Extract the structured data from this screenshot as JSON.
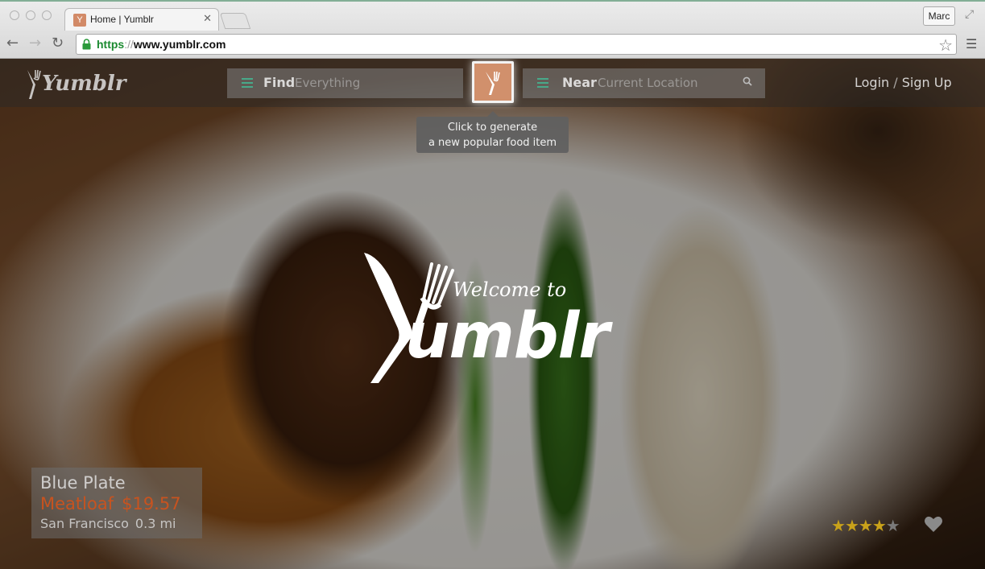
{
  "browser": {
    "tab_title": "Home | Yumblr",
    "tab_favicon": "Y",
    "profile_name": "Marc",
    "url_scheme": "https",
    "url_sep": "://",
    "url_host": "www.yumblr.com"
  },
  "header": {
    "logo_text": "Yumblr",
    "find_label": "Find",
    "find_placeholder": "Everything",
    "near_label": "Near",
    "near_placeholder": "Current Location",
    "generate_tooltip_line1": "Click to generate",
    "generate_tooltip_line2": "a new popular food item",
    "login_label": "Login",
    "login_sep": "/",
    "signup_label": "Sign Up"
  },
  "hero": {
    "welcome_text": "Welcome to",
    "brand_word": "umblr"
  },
  "featured": {
    "restaurant": "Blue Plate",
    "dish": "Meatloaf",
    "price": "$19.57",
    "city": "San Francisco",
    "distance": "0.3 mi",
    "rating": 4,
    "rating_max": 5
  },
  "colors": {
    "accent": "#d1906c",
    "dish_color": "#c8531f",
    "star_on": "#c9a21a",
    "star_off": "#7a7a7a"
  },
  "icons": {
    "find": "list-icon",
    "near": "list-icon",
    "search": "search-icon",
    "favorite": "heart-icon"
  }
}
